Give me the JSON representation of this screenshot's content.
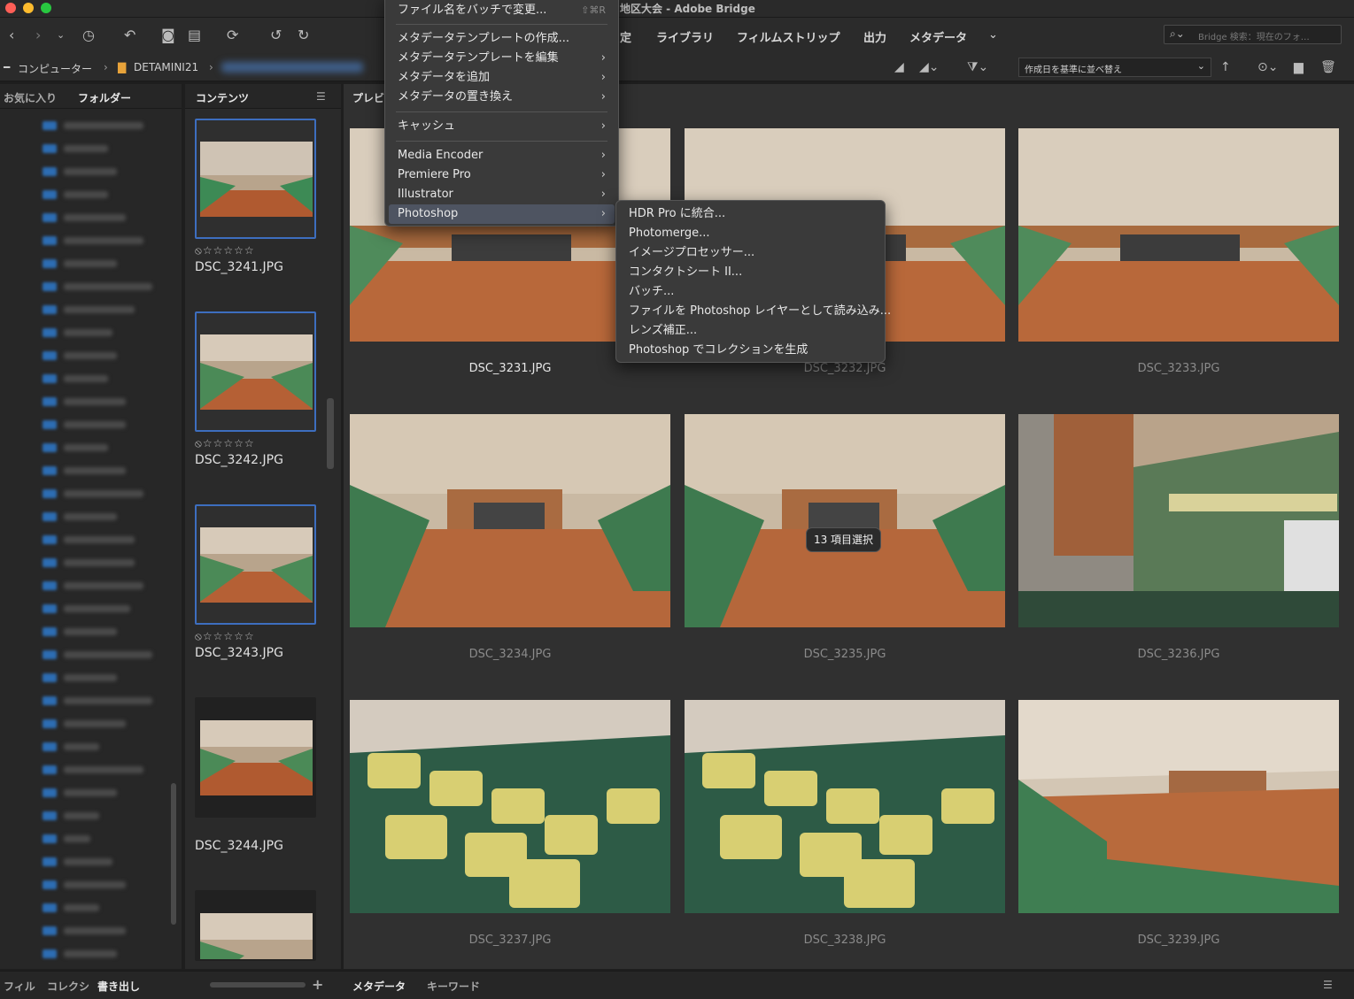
{
  "window": {
    "title": "地区大会 - Adobe Bridge"
  },
  "traffic_colors": [
    "#ff5f57",
    "#febc2e",
    "#28c840"
  ],
  "workspaces": [
    "定",
    "ライブラリ",
    "フィルムストリップ",
    "出力",
    "メタデータ"
  ],
  "search": {
    "placeholder": "Bridge 検索：現在のフォ…"
  },
  "path": {
    "root": "コンピューター",
    "folder": "DETAMINI21"
  },
  "sort": {
    "label": "作成日を基準に並べ替え"
  },
  "left_tabs": [
    "お気に入り",
    "フォルダー"
  ],
  "content_tab": "コンテンツ",
  "preview_tab": "プレビ",
  "content_items": [
    {
      "name": "DSC_3241.JPG",
      "stars": "⦸☆☆☆☆☆"
    },
    {
      "name": "DSC_3242.JPG",
      "stars": "⦸☆☆☆☆☆"
    },
    {
      "name": "DSC_3243.JPG",
      "stars": "⦸☆☆☆☆☆"
    },
    {
      "name": "DSC_3244.JPG",
      "stars": ""
    }
  ],
  "grid_items": [
    "DSC_3231.JPG",
    "DSC_3232.JPG",
    "DSC_3233.JPG",
    "DSC_3234.JPG",
    "DSC_3235.JPG",
    "DSC_3236.JPG",
    "DSC_3237.JPG",
    "DSC_3238.JPG",
    "DSC_3239.JPG"
  ],
  "selection_badge": "13 項目選択",
  "bottom_tabs_left": [
    "フィル",
    "コレクシ",
    "書き出し"
  ],
  "bottom_tabs_right": [
    "メタデータ",
    "キーワード"
  ],
  "main_menu": {
    "items": [
      {
        "label": "ファイル名をバッチで変更...",
        "shortcut": "⇧⌘R"
      },
      {
        "label": "メタデータテンプレートの作成..."
      },
      {
        "label": "メタデータテンプレートを編集",
        "arrow": "›"
      },
      {
        "label": "メタデータを追加",
        "arrow": "›"
      },
      {
        "label": "メタデータの置き換え",
        "arrow": "›"
      },
      {
        "label": "キャッシュ",
        "arrow": "›"
      },
      {
        "label": "Media Encoder",
        "arrow": "›"
      },
      {
        "label": "Premiere Pro",
        "arrow": "›"
      },
      {
        "label": "Illustrator",
        "arrow": "›"
      },
      {
        "label": "Photoshop",
        "arrow": "›"
      }
    ]
  },
  "photoshop_submenu": {
    "items": [
      "HDR Pro に統合...",
      "Photomerge...",
      "イメージプロセッサー...",
      "コンタクトシート II...",
      "バッチ...",
      "ファイルを Photoshop レイヤーとして読み込み...",
      "レンズ補正...",
      "Photoshop でコレクションを生成"
    ]
  }
}
